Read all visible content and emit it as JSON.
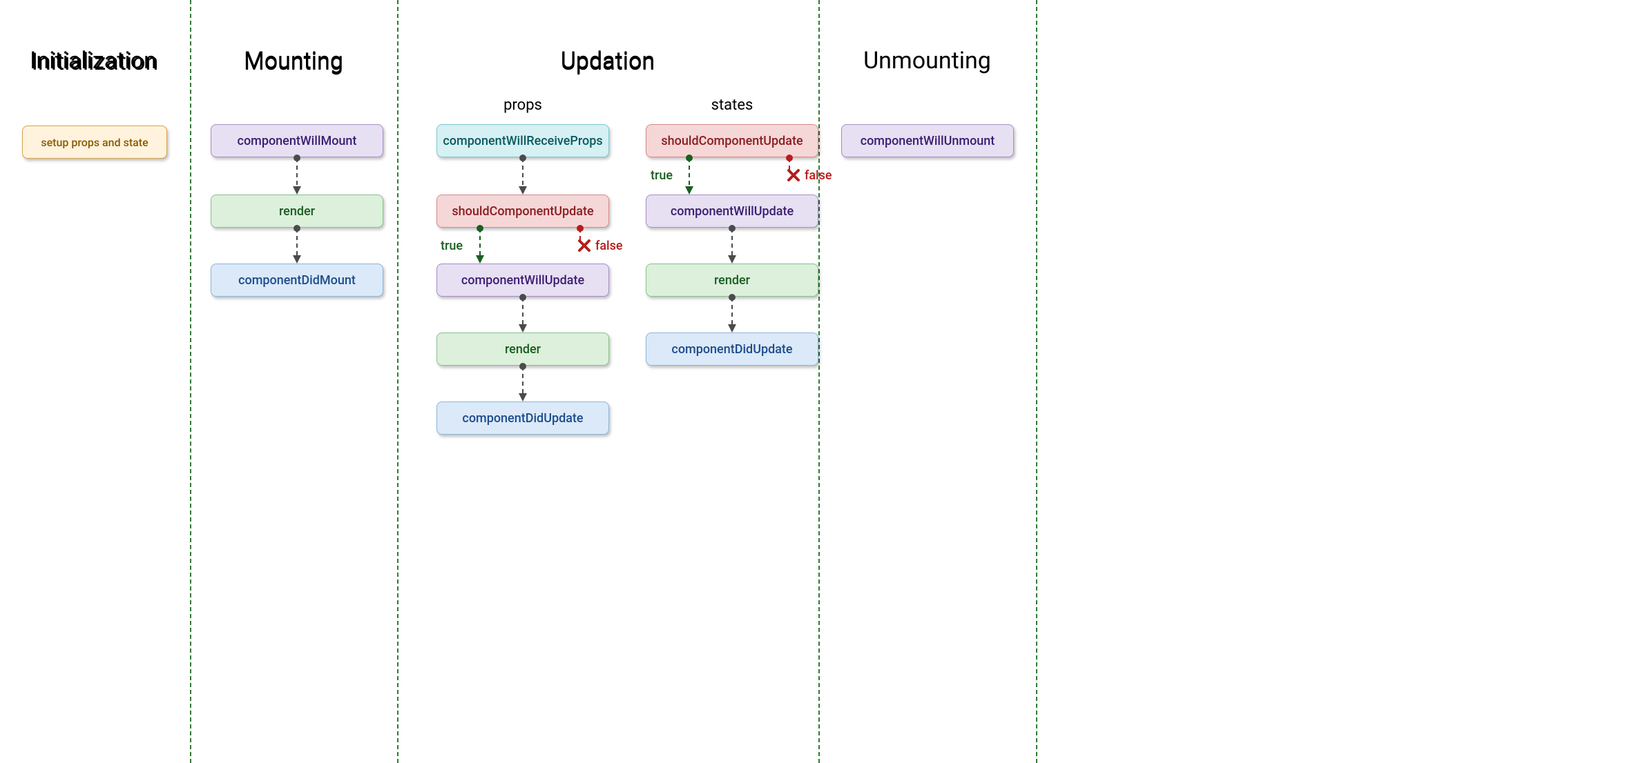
{
  "phases": {
    "init": {
      "title": "Initialization"
    },
    "mount": {
      "title": "Mounting"
    },
    "update": {
      "title": "Updation",
      "props_label": "props",
      "states_label": "states"
    },
    "unmount": {
      "title": "Unmounting"
    }
  },
  "nodes": {
    "setup": "setup props and state",
    "willMount": "componentWillMount",
    "mountRender": "render",
    "didMount": "componentDidMount",
    "willReceiveProps": "componentWillReceiveProps",
    "shouldUpdateProps": "shouldComponentUpdate",
    "willUpdateProps": "componentWillUpdate",
    "renderProps": "render",
    "didUpdateProps": "componentDidUpdate",
    "shouldUpdateStates": "shouldComponentUpdate",
    "willUpdateStates": "componentWillUpdate",
    "renderStates": "render",
    "didUpdateStates": "componentDidUpdate",
    "willUnmount": "componentWillUnmount"
  },
  "labels": {
    "true": "true",
    "false": "false"
  }
}
